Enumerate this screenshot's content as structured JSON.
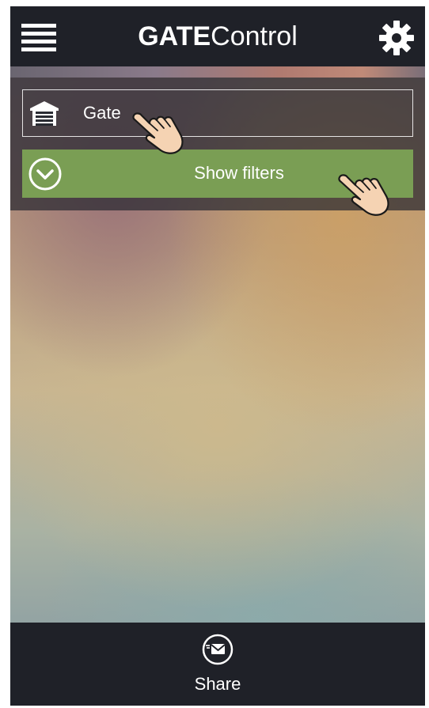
{
  "header": {
    "title_bold": "GATE",
    "title_regular": "Control",
    "menu_icon": "hamburger-menu-icon",
    "settings_icon": "gear-icon"
  },
  "gate_selector": {
    "icon": "garage-door-icon",
    "label": "Gate"
  },
  "filters_button": {
    "icon": "chevron-down-circle-icon",
    "label": "Show filters",
    "color": "#7a9e54"
  },
  "footer": {
    "share_icon": "envelope-icon",
    "share_label": "Share"
  },
  "colors": {
    "bar_background": "#1f2128",
    "text": "#ffffff",
    "accent_green": "#7a9e54"
  }
}
